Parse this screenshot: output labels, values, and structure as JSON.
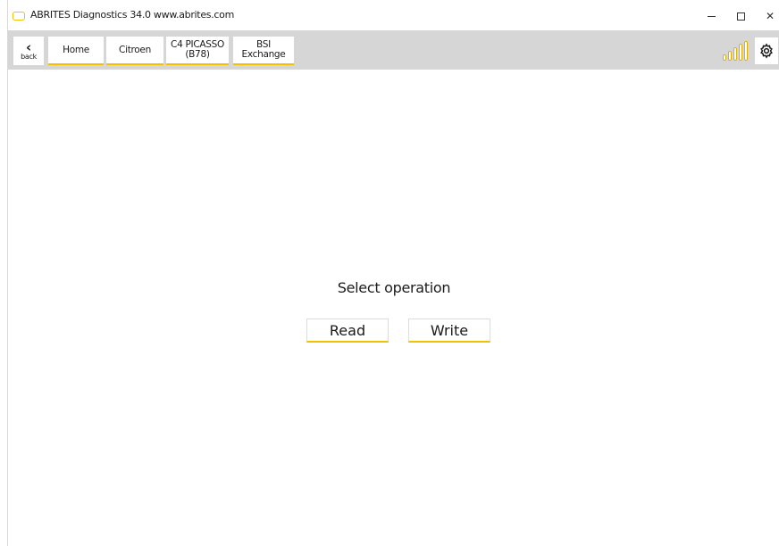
{
  "window": {
    "title": "ABRITES Diagnostics 34.0  www.abrites.com",
    "controls": {
      "minimize": "–",
      "maximize": "□",
      "close": "✕"
    }
  },
  "toolbar": {
    "back_label": "back",
    "breadcrumbs": [
      "Home",
      "Citroen",
      "C4 PICASSO",
      "(B78)",
      "BSI",
      "Exchange"
    ],
    "signal_icon": "signal-bars-icon",
    "settings_icon": "gear-icon"
  },
  "main": {
    "heading": "Select operation",
    "read_label": "Read",
    "write_label": "Write"
  },
  "colors": {
    "accent": "#f2c200",
    "toolbar_bg": "#d6d6d6",
    "text": "#1a1a1a"
  }
}
